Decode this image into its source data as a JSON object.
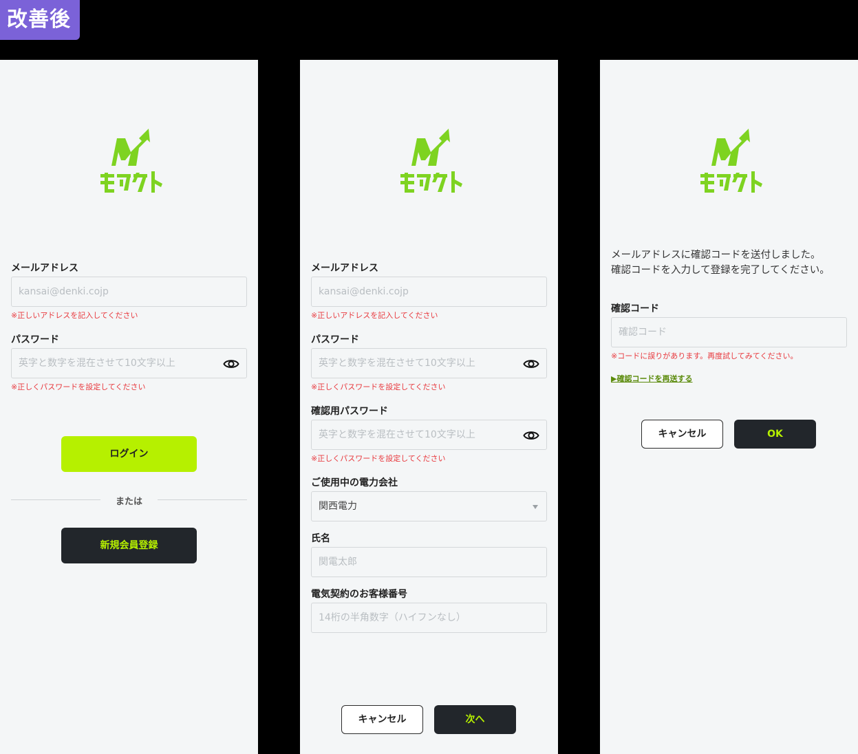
{
  "badge": "改善後",
  "logo": {
    "text": "モアクト",
    "color": "#7ed321"
  },
  "colors": {
    "accent": "#b6f000",
    "dark": "#22262b",
    "error": "#e8383d",
    "badge": "#7b62d8"
  },
  "icons": {
    "eye": "eye-icon",
    "caret": "chevron-down-icon",
    "arrow": "arrow-up-right-icon"
  },
  "login": {
    "email_label": "メールアドレス",
    "email_placeholder": "kansai@denki.cojp",
    "email_error": "※正しいアドレスを記入してください",
    "password_label": "パスワード",
    "password_placeholder": "英字と数字を混在させて10文字以上",
    "password_error": "※正しくパスワードを設定してください",
    "login_button": "ログイン",
    "or_text": "または",
    "register_button": "新規会員登録"
  },
  "register": {
    "email_label": "メールアドレス",
    "email_placeholder": "kansai@denki.cojp",
    "email_error": "※正しいアドレスを記入してください",
    "password_label": "パスワード",
    "password_placeholder": "英字と数字を混在させて10文字以上",
    "password_error": "※正しくパスワードを設定してください",
    "confirm_label": "確認用パスワード",
    "confirm_placeholder": "英字と数字を混在させて10文字以上",
    "confirm_error": "※正しくパスワードを設定してください",
    "company_label": "ご使用中の電力会社",
    "company_value": "関西電力",
    "name_label": "氏名",
    "name_placeholder": "関電太郎",
    "customer_label": "電気契約のお客様番号",
    "customer_placeholder": "14桁の半角数字（ハイフンなし）",
    "cancel_button": "キャンセル",
    "next_button": "次へ"
  },
  "verify": {
    "message_line1": "メールアドレスに確認コードを送付しました。",
    "message_line2": "確認コードを入力して登録を完了してください。",
    "code_label": "確認コード",
    "code_placeholder": "確認コード",
    "code_error": "※コードに誤りがあります。再度試してみてください。",
    "resend_link": "▶確認コードを再送する",
    "cancel_button": "キャンセル",
    "ok_button": "OK"
  }
}
